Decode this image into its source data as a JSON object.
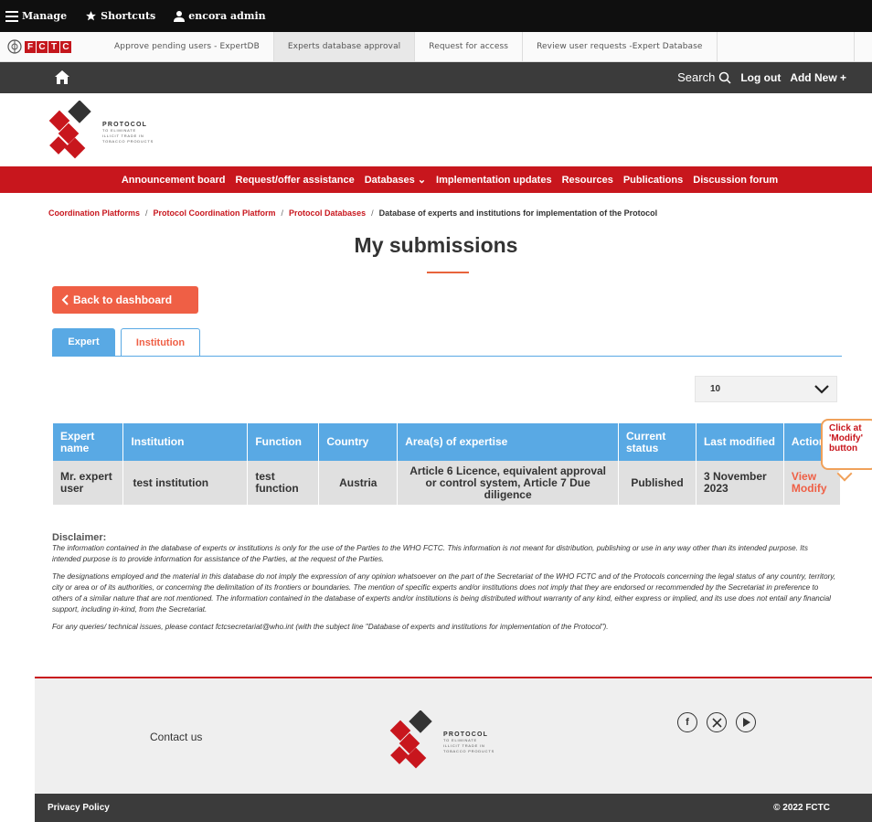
{
  "admin_bar": {
    "manage": "Manage",
    "shortcuts": "Shortcuts",
    "user": "encora admin"
  },
  "shortcut_tabs": [
    {
      "label": "Approve pending users - ExpertDB"
    },
    {
      "label": "Experts database approval"
    },
    {
      "label": "Request for access"
    },
    {
      "label": "Review user requests -Expert Database"
    }
  ],
  "site_bar": {
    "search": "Search",
    "logout": "Log out",
    "add_new": "Add New +"
  },
  "logo": {
    "title": "PROTOCOL",
    "line1": "TO ELIMINATE",
    "line2": "ILLICIT TRADE IN",
    "line3": "TOBACCO PRODUCTS",
    "fctc_letters": [
      "F",
      "C",
      "T",
      "C"
    ]
  },
  "nav": [
    "Announcement board",
    "Request/offer assistance",
    "Databases ⌄",
    "Implementation updates",
    "Resources",
    "Publications",
    "Discussion forum"
  ],
  "breadcrumb": {
    "items": [
      "Coordination Platforms",
      "Protocol Coordination Platform",
      "Protocol Databases"
    ],
    "current": "Database of experts and institutions for implementation of the Protocol"
  },
  "page_title": "My submissions",
  "back_button": "Back to dashboard",
  "tabs": {
    "expert": "Expert",
    "institution": "Institution"
  },
  "page_size": {
    "selected": "10"
  },
  "table": {
    "headers": [
      "Expert name",
      "Institution",
      "Function",
      "Country",
      "Area(s) of expertise",
      "Current status",
      "Last modified",
      "Actions"
    ],
    "rows": [
      {
        "expert_name": "Mr. expert user",
        "institution": "test institution",
        "function": "test function",
        "country": "Austria",
        "expertise": "Article 6 Licence, equivalent approval or control system, Article 7 Due diligence",
        "status": "Published",
        "last_modified": "3 November 2023",
        "action_view": "View",
        "action_modify": "Modify"
      }
    ]
  },
  "callout": "Click at 'Modify' button",
  "disclaimer": {
    "heading": "Disclaimer:",
    "p1": "The information contained in the database of experts or institutions is only for the use of the Parties to the WHO FCTC. This information is not meant for distribution, publishing or use in any way other than its intended purpose. Its intended purpose is to provide information for assistance of the Parties, at the request of the Parties.",
    "p2": "The designations employed and the material in this database do not imply the expression of any opinion whatsoever on the part of the Secretariat of the WHO FCTC and of the Protocols concerning the legal status of any country, territory, city or area or of its authorities, or concerning the delimitation of its frontiers or boundaries. The mention of specific experts and/or institutions does not imply that they are endorsed or recommended by the Secretariat in preference to others of a similar nature that are not mentioned. The information contained in the database of experts and/or institutions is being distributed without warranty of any kind, either express or implied, and its use does not entail any financial support, including in-kind, from the Secretariat.",
    "p3": "For any queries/ technical issues, please contact fctcsecretariat@who.int (with the subject line \"Database of experts and institutions for implementation of the Protocol\")."
  },
  "footer": {
    "contact": "Contact us",
    "privacy": "Privacy Policy",
    "copyright": "© 2022 FCTC"
  },
  "colors": {
    "brand_red": "#c8161d",
    "accent_orange": "#ef5f45",
    "table_blue": "#59a9e4",
    "dark_bar": "#3b3b3b"
  }
}
